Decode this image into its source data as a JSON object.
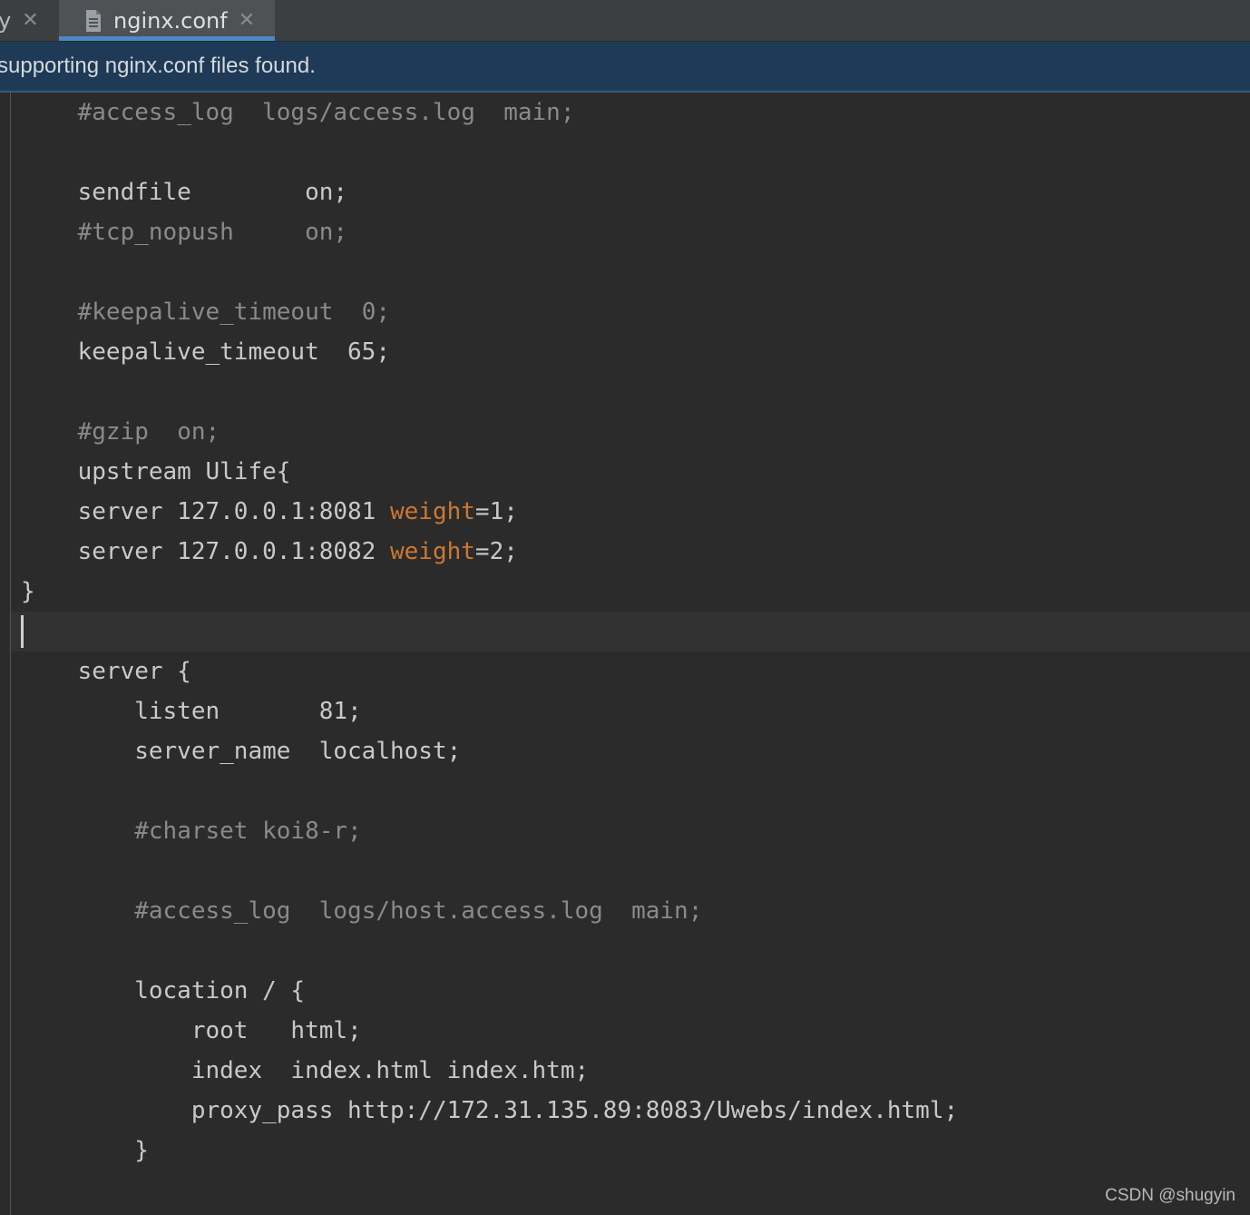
{
  "tabs": [
    {
      "label": "y",
      "close": "✕"
    },
    {
      "label": "nginx.conf",
      "close": "✕",
      "icon": "file-icon"
    }
  ],
  "banner": {
    "text": "supporting nginx.conf files found."
  },
  "editor": {
    "lines": [
      [
        {
          "t": "    "
        },
        {
          "t": "#access_log  logs/access.log  main;",
          "c": "cmt"
        }
      ],
      [],
      [
        {
          "t": "    sendfile        on;"
        }
      ],
      [
        {
          "t": "    "
        },
        {
          "t": "#tcp_nopush     on;",
          "c": "cmt"
        }
      ],
      [],
      [
        {
          "t": "    "
        },
        {
          "t": "#keepalive_timeout  0;",
          "c": "cmt"
        }
      ],
      [
        {
          "t": "    keepalive_timeout  65;"
        }
      ],
      [],
      [
        {
          "t": "    "
        },
        {
          "t": "#gzip  on;",
          "c": "cmt"
        }
      ],
      [
        {
          "t": "    upstream Ulife{"
        }
      ],
      [
        {
          "t": "    server 127.0.0.1:8081 "
        },
        {
          "t": "weight",
          "c": "kw"
        },
        {
          "t": "=1;"
        }
      ],
      [
        {
          "t": "    server 127.0.0.1:8082 "
        },
        {
          "t": "weight",
          "c": "kw"
        },
        {
          "t": "=2;"
        }
      ],
      [
        {
          "t": "}"
        }
      ],
      [],
      [
        {
          "t": "    server {"
        }
      ],
      [
        {
          "t": "        listen       81;"
        }
      ],
      [
        {
          "t": "        server_name  localhost;"
        }
      ],
      [],
      [
        {
          "t": "        "
        },
        {
          "t": "#charset koi8-r;",
          "c": "cmt"
        }
      ],
      [],
      [
        {
          "t": "        "
        },
        {
          "t": "#access_log  logs/host.access.log  main;",
          "c": "cmt"
        }
      ],
      [],
      [
        {
          "t": "        location / {"
        }
      ],
      [
        {
          "t": "            root   html;"
        }
      ],
      [
        {
          "t": "            index  index.html index.htm;"
        }
      ],
      [
        {
          "t": "            proxy_pass http://172.31.135.89:8083/Uwebs/index.html;"
        }
      ],
      [
        {
          "t": "        }"
        }
      ]
    ]
  },
  "watermark": "CSDN @shugyin"
}
